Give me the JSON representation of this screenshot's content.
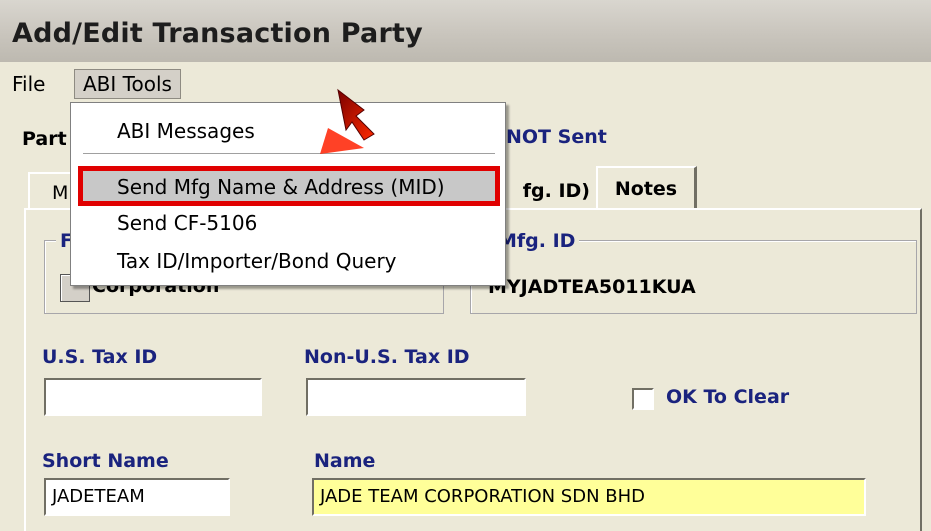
{
  "window": {
    "title": "Add/Edit Transaction Party"
  },
  "menubar": {
    "file": "File",
    "abi_tools": "ABI Tools"
  },
  "abi_menu": {
    "items": [
      "ABI Messages",
      "Send Mfg Name & Address (MID)",
      "Send CF-5106",
      "Tax ID/Importer/Bond Query"
    ],
    "highlighted_index": 1,
    "highlight_color": "#e00000"
  },
  "header": {
    "party_label": "Part",
    "status": "NOT Sent"
  },
  "tabs": {
    "first_partial": "M",
    "mfg_partial": "fg. ID)",
    "notes": "Notes"
  },
  "type_group": {
    "caption": "F",
    "value": "Corporation"
  },
  "mfg_group": {
    "caption": "Mfg. ID",
    "value": "MYJADTEA5011KUA"
  },
  "fields": {
    "us_tax_id": {
      "label": "U.S. Tax ID",
      "value": ""
    },
    "non_us_tax_id": {
      "label": "Non-U.S. Tax ID",
      "value": ""
    },
    "ok_to_clear": {
      "label": "OK To Clear",
      "checked": false
    },
    "short_name": {
      "label": "Short Name",
      "value": "JADETEAM"
    },
    "name": {
      "label": "Name",
      "value": "JADE TEAM CORPORATION SDN BHD",
      "highlight_color": "#ffff99"
    }
  },
  "colors": {
    "label_blue": "#1a237e",
    "window_bg": "#ece9d8"
  }
}
